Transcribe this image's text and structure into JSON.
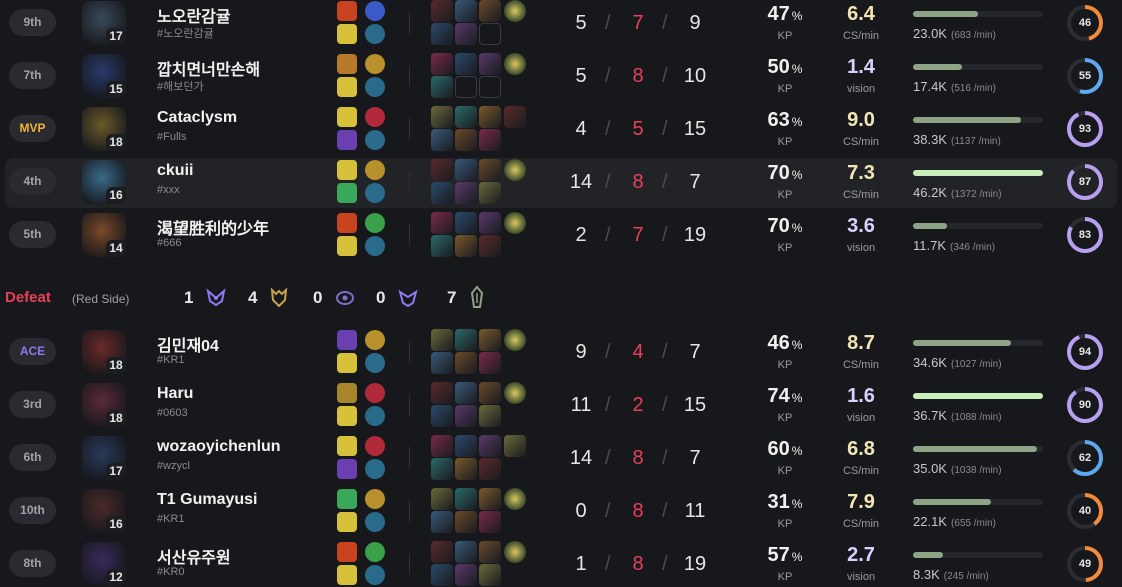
{
  "defeat_bar": {
    "result": "Defeat",
    "side": "(Red Side)",
    "result_color": "#e84057",
    "objectives": [
      {
        "icon": "grub-icon",
        "count": "1"
      },
      {
        "icon": "dragon-icon",
        "count": "4"
      },
      {
        "icon": "herald-icon",
        "count": "0"
      },
      {
        "icon": "baron-icon",
        "count": "0"
      },
      {
        "icon": "tower-icon",
        "count": "7"
      }
    ]
  },
  "column_labels": {
    "kp": "KP",
    "cs_per_min": "CS/min",
    "vision": "vision"
  },
  "colors": {
    "deaths": "#e84057",
    "damage_bar": "#8ea486",
    "damage_bar_top": "#c8f0b8",
    "ring_orange": "#f08a3c",
    "ring_purple": "#b89ff0",
    "ring_blue": "#5fa8f0",
    "cs_value": "#f2e6b4",
    "vision_value": "#d9d2ff",
    "mvp": "#f0b232",
    "ace": "#8b7bf0"
  },
  "players": [
    {
      "team": "top",
      "rank": "9th",
      "champion_icon": "champion-portrait",
      "level": "17",
      "name": "노오란감귤",
      "tag": "#노오란감귤",
      "spells": [
        "ignite-spell-icon",
        "flash-spell-icon"
      ],
      "runes": [
        "sorcery-rune-icon",
        "rune-shard-icon"
      ],
      "items": [
        "item",
        "item",
        "item",
        "ward-item",
        "item",
        "item",
        "empty-slot"
      ],
      "kills": "5",
      "deaths": "7",
      "assists": "9",
      "kp": "47",
      "stat_value": "6.4",
      "stat_label": "CS/min",
      "damage": "23.0K",
      "damage_per_min": "(683 /min)",
      "damage_fraction": 0.5,
      "score": "46",
      "score_fraction": 0.46
    },
    {
      "team": "top",
      "rank": "7th",
      "champion_icon": "champion-portrait",
      "level": "15",
      "name": "깝치면너만손해",
      "tag": "#해보던가",
      "spells": [
        "exhaust-spell-icon",
        "flash-spell-icon"
      ],
      "runes": [
        "precision-rune-icon",
        "rune-shard-icon"
      ],
      "items": [
        "item",
        "item",
        "item",
        "ward-item",
        "item",
        "empty-slot",
        "empty-slot"
      ],
      "kills": "5",
      "deaths": "8",
      "assists": "10",
      "kp": "50",
      "stat_value": "1.4",
      "stat_label": "vision",
      "damage": "17.4K",
      "damage_per_min": "(516 /min)",
      "damage_fraction": 0.38,
      "score": "55",
      "score_fraction": 0.55
    },
    {
      "team": "top",
      "rank": "MVP",
      "champion_icon": "champion-portrait",
      "level": "18",
      "name": "Cataclysm",
      "tag": "#Fulls",
      "spells": [
        "flash-spell-icon",
        "teleport-spell-icon"
      ],
      "runes": [
        "domination-rune-icon",
        "rune-shard-icon"
      ],
      "items": [
        "item",
        "item",
        "item",
        "item",
        "item",
        "item",
        "item"
      ],
      "kills": "4",
      "deaths": "5",
      "assists": "15",
      "kp": "63",
      "stat_value": "9.0",
      "stat_label": "CS/min",
      "damage": "38.3K",
      "damage_per_min": "(1137 /min)",
      "damage_fraction": 0.83,
      "score": "93",
      "score_fraction": 0.93
    },
    {
      "team": "top",
      "rank": "4th",
      "champion_icon": "champion-portrait",
      "level": "16",
      "name": "ckuii",
      "tag": "#xxx",
      "spells": [
        "flash-spell-icon",
        "heal-spell-icon"
      ],
      "runes": [
        "precision-rune-icon",
        "rune-shard-icon"
      ],
      "items": [
        "item",
        "item",
        "item",
        "ward-item",
        "item",
        "item",
        "item"
      ],
      "kills": "14",
      "deaths": "8",
      "assists": "7",
      "kp": "70",
      "stat_value": "7.3",
      "stat_label": "CS/min",
      "damage": "46.2K",
      "damage_per_min": "(1372 /min)",
      "damage_fraction": 1.0,
      "score": "87",
      "score_fraction": 0.87,
      "highlight": true
    },
    {
      "team": "top",
      "rank": "5th",
      "champion_icon": "champion-portrait",
      "level": "14",
      "name": "渴望胜利的少年",
      "tag": "#666",
      "spells": [
        "ignite-spell-icon",
        "flash-spell-icon"
      ],
      "runes": [
        "resolve-rune-icon",
        "rune-shard-icon"
      ],
      "items": [
        "item",
        "item",
        "item",
        "ward-item",
        "item",
        "item",
        "item"
      ],
      "kills": "2",
      "deaths": "7",
      "assists": "19",
      "kp": "70",
      "stat_value": "3.6",
      "stat_label": "vision",
      "damage": "11.7K",
      "damage_per_min": "(346 /min)",
      "damage_fraction": 0.26,
      "score": "83",
      "score_fraction": 0.83
    },
    {
      "team": "bottom",
      "rank": "ACE",
      "champion_icon": "champion-portrait",
      "level": "18",
      "name": "김민재04",
      "tag": "#KR1",
      "spells": [
        "teleport-spell-icon",
        "flash-spell-icon"
      ],
      "runes": [
        "precision-rune-icon",
        "rune-shard-icon"
      ],
      "items": [
        "item",
        "item",
        "item",
        "ward-item",
        "item",
        "item",
        "item"
      ],
      "kills": "9",
      "deaths": "4",
      "assists": "7",
      "kp": "46",
      "stat_value": "8.7",
      "stat_label": "CS/min",
      "damage": "34.6K",
      "damage_per_min": "(1027 /min)",
      "damage_fraction": 0.75,
      "score": "94",
      "score_fraction": 0.94
    },
    {
      "team": "bottom",
      "rank": "3rd",
      "champion_icon": "champion-portrait",
      "level": "18",
      "name": "Haru",
      "tag": "#0603",
      "spells": [
        "smite-spell-icon",
        "flash-spell-icon"
      ],
      "runes": [
        "domination-rune-icon",
        "rune-shard-icon"
      ],
      "items": [
        "item",
        "item",
        "item",
        "ward-item",
        "item",
        "item",
        "item"
      ],
      "kills": "11",
      "deaths": "2",
      "assists": "15",
      "kp": "74",
      "stat_value": "1.6",
      "stat_label": "vision",
      "damage": "36.7K",
      "damage_per_min": "(1088 /min)",
      "damage_fraction": 1.0,
      "score": "90",
      "score_fraction": 0.9
    },
    {
      "team": "bottom",
      "rank": "6th",
      "champion_icon": "champion-portrait",
      "level": "17",
      "name": "wozaoyichenlun",
      "tag": "#wzycl",
      "spells": [
        "flash-spell-icon",
        "teleport-spell-icon"
      ],
      "runes": [
        "domination-rune-icon",
        "rune-shard-icon"
      ],
      "items": [
        "item",
        "item",
        "item",
        "item",
        "item",
        "item",
        "item"
      ],
      "kills": "14",
      "deaths": "8",
      "assists": "7",
      "kp": "60",
      "stat_value": "6.8",
      "stat_label": "CS/min",
      "damage": "35.0K",
      "damage_per_min": "(1038 /min)",
      "damage_fraction": 0.95,
      "score": "62",
      "score_fraction": 0.62
    },
    {
      "team": "bottom",
      "rank": "10th",
      "champion_icon": "champion-portrait",
      "level": "16",
      "name": "T1 Gumayusi",
      "tag": "#KR1",
      "spells": [
        "heal-spell-icon",
        "flash-spell-icon"
      ],
      "runes": [
        "precision-rune-icon",
        "rune-shard-icon"
      ],
      "items": [
        "item",
        "item",
        "item",
        "ward-item",
        "item",
        "item",
        "item"
      ],
      "kills": "0",
      "deaths": "8",
      "assists": "11",
      "kp": "31",
      "stat_value": "7.9",
      "stat_label": "CS/min",
      "damage": "22.1K",
      "damage_per_min": "(655 /min)",
      "damage_fraction": 0.6,
      "score": "40",
      "score_fraction": 0.4
    },
    {
      "team": "bottom",
      "rank": "8th",
      "champion_icon": "champion-portrait",
      "level": "12",
      "name": "서산유주원",
      "tag": "#KR0",
      "spells": [
        "ignite-spell-icon",
        "flash-spell-icon"
      ],
      "runes": [
        "resolve-rune-icon",
        "rune-shard-icon"
      ],
      "items": [
        "item",
        "item",
        "item",
        "ward-item",
        "item",
        "item",
        "item"
      ],
      "kills": "1",
      "deaths": "8",
      "assists": "19",
      "kp": "57",
      "stat_value": "2.7",
      "stat_label": "vision",
      "damage": "8.3K",
      "damage_per_min": "(245 /min)",
      "damage_fraction": 0.23,
      "score": "49",
      "score_fraction": 0.49
    }
  ]
}
